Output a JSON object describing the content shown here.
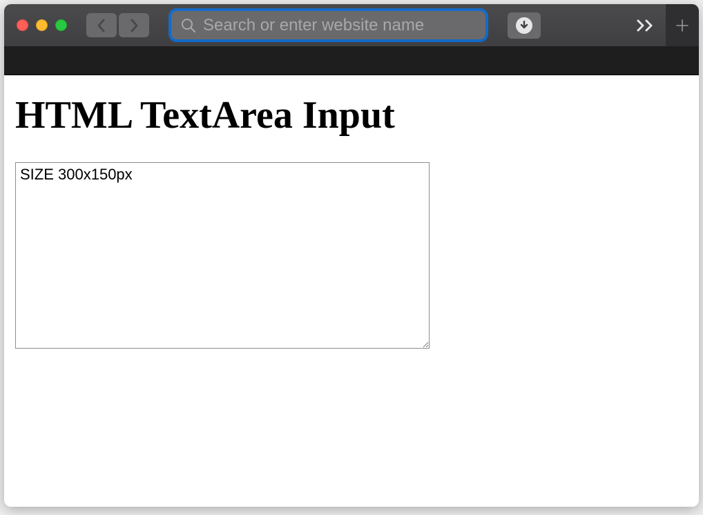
{
  "browser": {
    "address_placeholder": "Search or enter website name",
    "address_value": ""
  },
  "page": {
    "heading": "HTML TextArea Input",
    "textarea_value": "SIZE 300x150px"
  }
}
